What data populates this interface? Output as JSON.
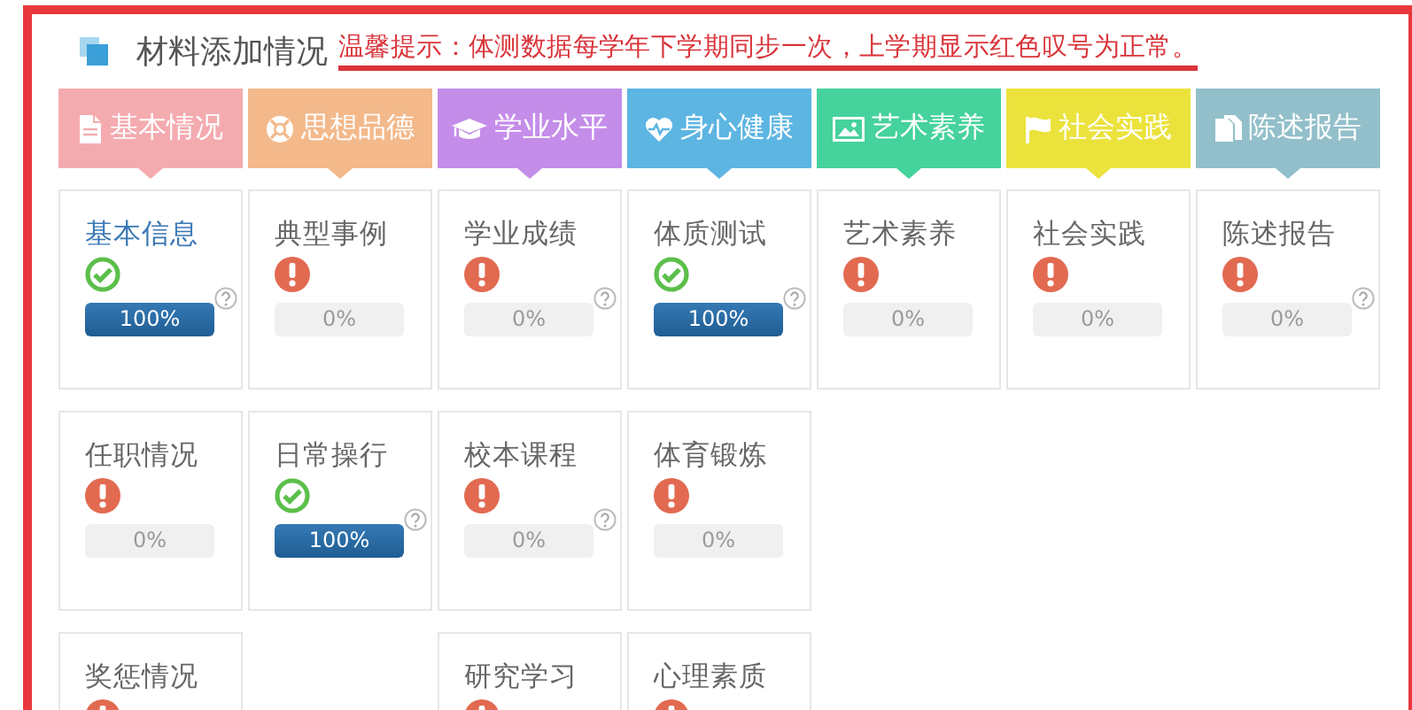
{
  "header": {
    "title": "材料添加情况",
    "notice": "温馨提示：体测数据每学年下学期同步一次，上学期显示红色叹号为正常。"
  },
  "tabs": [
    {
      "label": "基本情况",
      "color": "#f4abb0"
    },
    {
      "label": "思想品德",
      "color": "#f3b98b"
    },
    {
      "label": "学业水平",
      "color": "#c48de9"
    },
    {
      "label": "身心健康",
      "color": "#5db5e2"
    },
    {
      "label": "艺术素养",
      "color": "#45d29c"
    },
    {
      "label": "社会实践",
      "color": "#ebe23c"
    },
    {
      "label": "陈述报告",
      "color": "#92bfca"
    }
  ],
  "rows": [
    {
      "cards": [
        {
          "kind": "card",
          "title": "基本信息",
          "selected": true,
          "complete": true,
          "help": true,
          "level": 1,
          "reading": "100%"
        },
        {
          "kind": "card",
          "title": "典型事例",
          "selected": false,
          "complete": false,
          "help": false,
          "level": 0,
          "reading": "0%"
        },
        {
          "kind": "card",
          "title": "学业成绩",
          "selected": false,
          "complete": false,
          "help": true,
          "level": 0,
          "reading": "0%"
        },
        {
          "kind": "card",
          "title": "体质测试",
          "selected": false,
          "complete": true,
          "help": true,
          "level": 1,
          "reading": "100%"
        },
        {
          "kind": "card",
          "title": "艺术素养",
          "selected": false,
          "complete": false,
          "help": false,
          "level": 0,
          "reading": "0%"
        },
        {
          "kind": "card",
          "title": "社会实践",
          "selected": false,
          "complete": false,
          "help": false,
          "level": 0,
          "reading": "0%"
        },
        {
          "kind": "card",
          "title": "陈述报告",
          "selected": false,
          "complete": false,
          "help": true,
          "level": 0,
          "reading": "0%"
        }
      ]
    },
    {
      "cards": [
        {
          "kind": "card",
          "title": "任职情况",
          "selected": false,
          "complete": false,
          "help": false,
          "level": 0,
          "reading": "0%"
        },
        {
          "kind": "card",
          "title": "日常操行",
          "selected": false,
          "complete": true,
          "help": true,
          "level": 1,
          "reading": "100%"
        },
        {
          "kind": "card",
          "title": "校本课程",
          "selected": false,
          "complete": false,
          "help": true,
          "level": 0,
          "reading": "0%"
        },
        {
          "kind": "card",
          "title": "体育锻炼",
          "selected": false,
          "complete": false,
          "help": false,
          "level": 0,
          "reading": "0%"
        }
      ]
    },
    {
      "cards": [
        {
          "kind": "card",
          "title": "奖惩情况",
          "selected": false,
          "complete": false
        },
        {
          "kind": "empty"
        },
        {
          "kind": "card",
          "title": "研究学习",
          "selected": false,
          "complete": false
        },
        {
          "kind": "card",
          "title": "心理素质",
          "selected": false,
          "complete": false
        }
      ]
    }
  ]
}
